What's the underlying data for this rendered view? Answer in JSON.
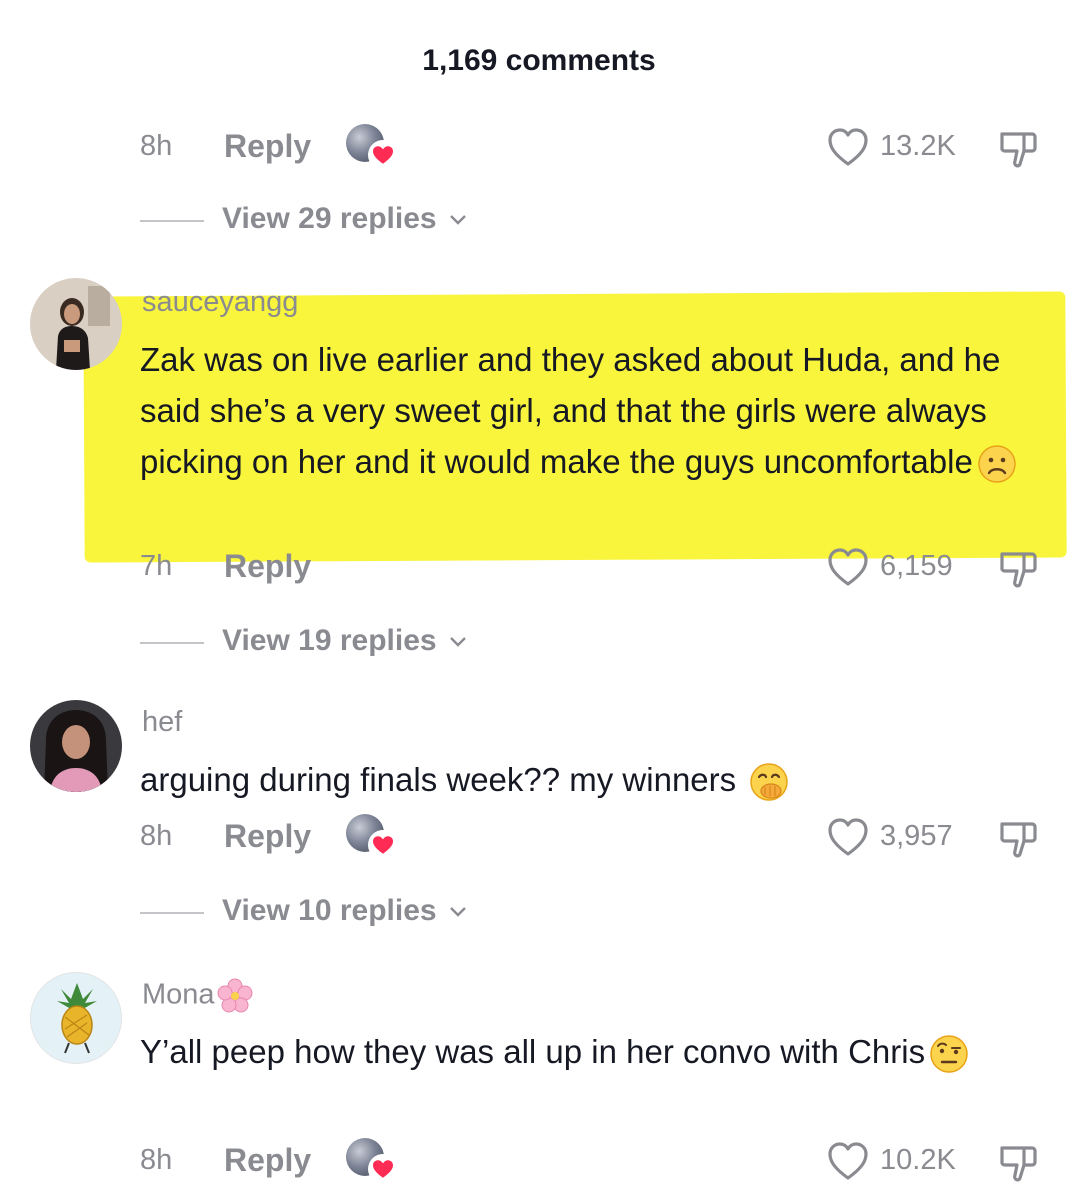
{
  "header": {
    "comment_count": "1,169 comments"
  },
  "comments": [
    {
      "time": "8h",
      "reply_label": "Reply",
      "likes": "13.2K",
      "view_replies": "View 29 replies",
      "creator_liked": true
    },
    {
      "username": "sauceyangg",
      "text": "Zak was on live earlier and they asked about Huda, and he said she’s a very sweet girl, and that the girls were always picking on her and it would make the guys uncomfortable",
      "emoji": "frowning-face",
      "highlighted": true,
      "highlight_color": "#f8f53c",
      "time": "7h",
      "reply_label": "Reply",
      "likes": "6,159",
      "view_replies": "View 19 replies",
      "creator_liked": false
    },
    {
      "username": "hef",
      "text": "arguing during finals week?? my winners",
      "emoji": "face-with-hand-over-mouth",
      "time": "8h",
      "reply_label": "Reply",
      "likes": "3,957",
      "view_replies": "View 10 replies",
      "creator_liked": true
    },
    {
      "username": "Mona",
      "username_emoji": "cherry-blossom",
      "text": "Y’all peep how they was all up in her convo with Chris",
      "emoji": "face-with-raised-eyebrow",
      "time": "8h",
      "reply_label": "Reply",
      "likes": "10.2K",
      "creator_liked": true
    }
  ],
  "colors": {
    "text_primary": "#161823",
    "text_secondary": "#8a8b91",
    "heart_red": "#fe2c55"
  }
}
